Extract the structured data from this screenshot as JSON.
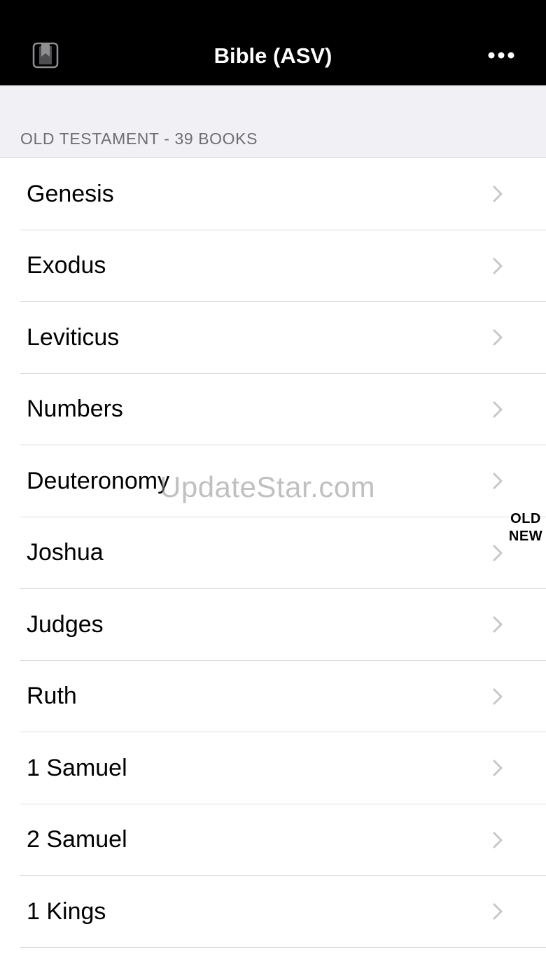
{
  "navbar": {
    "title": "Bible (ASV)",
    "left_icon": "bookmark-book-icon",
    "right_icon": "more-ellipsis-icon"
  },
  "section": {
    "header": "OLD TESTAMENT - 39 BOOKS"
  },
  "books": [
    {
      "name": "Genesis"
    },
    {
      "name": "Exodus"
    },
    {
      "name": "Leviticus"
    },
    {
      "name": "Numbers"
    },
    {
      "name": "Deuteronomy"
    },
    {
      "name": "Joshua"
    },
    {
      "name": "Judges"
    },
    {
      "name": "Ruth"
    },
    {
      "name": "1 Samuel"
    },
    {
      "name": "2 Samuel"
    },
    {
      "name": "1 Kings"
    }
  ],
  "index_bar": {
    "old": "OLD",
    "new": "NEW"
  },
  "watermark": "UpdateStar.com",
  "colors": {
    "navbar_bg": "#000000",
    "section_bg": "#f0f0f5",
    "section_text": "#6d6d72",
    "chevron": "#c7c7cc"
  }
}
